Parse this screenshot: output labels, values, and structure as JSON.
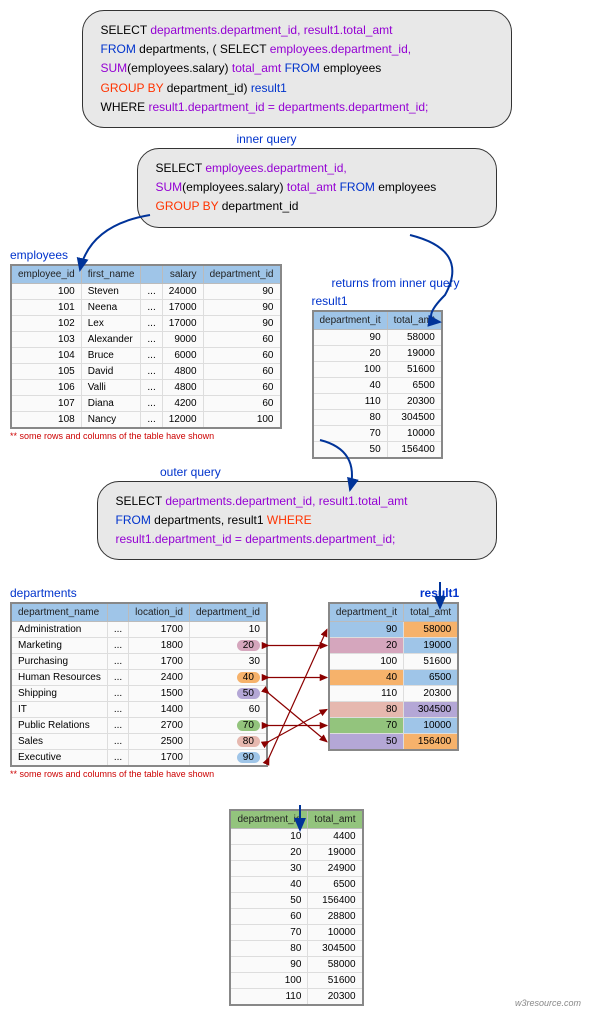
{
  "sql_main": {
    "line1a": "SELECT ",
    "line1b": "departments.department_id, result1.total_amt",
    "line2a": "FROM ",
    "line2b": "departments,  ( ",
    "line2c": "SELECT ",
    "line2d": "employees.department_id,",
    "line3a": "SUM",
    "line3b": "(employees.salary) ",
    "line3c": "total_amt  ",
    "line3d": "FROM ",
    "line3e": "employees",
    "line4a": "GROUP BY ",
    "line4b": "department_id",
    "line4c": ") ",
    "line4d": "result1",
    "line5a": "WHERE ",
    "line5b": "result1.department_id = departments.department_id;"
  },
  "label_inner": "inner query",
  "sql_inner": {
    "line1a": "SELECT ",
    "line1b": "employees.department_id,",
    "line2a": "SUM",
    "line2b": "(employees.salary) ",
    "line2c": "total_amt  ",
    "line2d": "FROM ",
    "line2e": "employees",
    "line3a": "GROUP BY ",
    "line3b": "department_id"
  },
  "label_employees": "employees",
  "employees": {
    "headers": [
      "employee_id",
      "first_name",
      "",
      "salary",
      "department_id"
    ],
    "rows": [
      [
        "100",
        "Steven",
        "...",
        "24000",
        "90"
      ],
      [
        "101",
        "Neena",
        "...",
        "17000",
        "90"
      ],
      [
        "102",
        "Lex",
        "...",
        "17000",
        "90"
      ],
      [
        "103",
        "Alexander",
        "...",
        "9000",
        "60"
      ],
      [
        "104",
        "Bruce",
        "...",
        "6000",
        "60"
      ],
      [
        "105",
        "David",
        "...",
        "4800",
        "60"
      ],
      [
        "106",
        "Valli",
        "...",
        "4800",
        "60"
      ],
      [
        "107",
        "Diana",
        "...",
        "4200",
        "60"
      ],
      [
        "108",
        "Nancy",
        "...",
        "12000",
        "100"
      ]
    ]
  },
  "label_returns": "returns from inner query",
  "label_result1_a": "result1",
  "result1_a": {
    "headers": [
      "department_it",
      "total_amt"
    ],
    "rows": [
      [
        "90",
        "58000"
      ],
      [
        "20",
        "19000"
      ],
      [
        "100",
        "51600"
      ],
      [
        "40",
        "6500"
      ],
      [
        "110",
        "20300"
      ],
      [
        "80",
        "304500"
      ],
      [
        "70",
        "10000"
      ],
      [
        "50",
        "156400"
      ]
    ]
  },
  "note_truncate": "** some rows and columns of the table have shown",
  "label_outer": "outer query",
  "sql_outer": {
    "line1a": "SELECT ",
    "line1b": "departments.department_id, result1.total_amt",
    "line2a": "FROM ",
    "line2b": "departments, result1 ",
    "line2c": "WHERE",
    "line3a": "result1.department_id = departments.department_id;"
  },
  "label_departments": "departments",
  "departments": {
    "headers": [
      "department_name",
      "",
      "location_id",
      "department_id"
    ],
    "rows": [
      [
        "Administration",
        "...",
        "1700",
        "10",
        ""
      ],
      [
        "Marketing",
        "...",
        "1800",
        "20",
        "c-pink"
      ],
      [
        "Purchasing",
        "...",
        "1700",
        "30",
        ""
      ],
      [
        "Human Resources",
        "...",
        "2400",
        "40",
        "c-orange"
      ],
      [
        "Shipping",
        "...",
        "1500",
        "50",
        "c-purple"
      ],
      [
        "IT",
        "...",
        "1400",
        "60",
        ""
      ],
      [
        "Public Relations",
        "...",
        "2700",
        "70",
        "c-green"
      ],
      [
        "Sales",
        "...",
        "2500",
        "80",
        "c-salmon"
      ],
      [
        "Executive",
        "...",
        "1700",
        "90",
        "c-blue"
      ]
    ]
  },
  "label_result1_b": "result1",
  "result1_b": {
    "headers": [
      "department_it",
      "total_amt"
    ],
    "rows": [
      [
        "90",
        "58000",
        "td-blue",
        "td-orange"
      ],
      [
        "20",
        "19000",
        "td-pink",
        "td-blue"
      ],
      [
        "100",
        "51600",
        "",
        ""
      ],
      [
        "40",
        "6500",
        "td-orange",
        "td-blue"
      ],
      [
        "110",
        "20300",
        "",
        ""
      ],
      [
        "80",
        "304500",
        "td-salmon",
        "td-purple"
      ],
      [
        "70",
        "10000",
        "td-green",
        "td-blue"
      ],
      [
        "50",
        "156400",
        "td-purple",
        "td-orange"
      ]
    ]
  },
  "final": {
    "headers": [
      "department_id",
      "total_amt"
    ],
    "rows": [
      [
        "10",
        "4400"
      ],
      [
        "20",
        "19000"
      ],
      [
        "30",
        "24900"
      ],
      [
        "40",
        "6500"
      ],
      [
        "50",
        "156400"
      ],
      [
        "60",
        "28800"
      ],
      [
        "70",
        "10000"
      ],
      [
        "80",
        "304500"
      ],
      [
        "90",
        "58000"
      ],
      [
        "100",
        "51600"
      ],
      [
        "110",
        "20300"
      ]
    ]
  },
  "footer": "w3resource.com"
}
